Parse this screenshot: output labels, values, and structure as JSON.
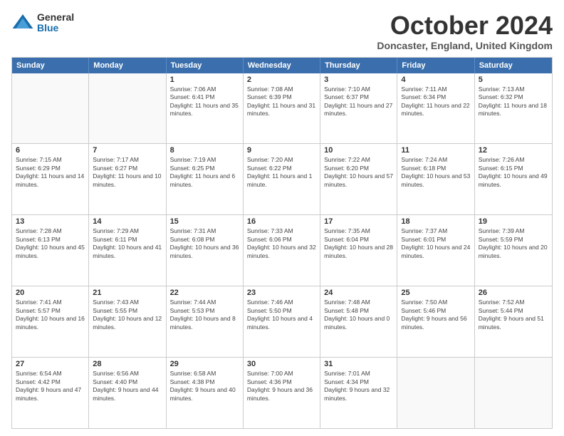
{
  "logo": {
    "general": "General",
    "blue": "Blue"
  },
  "title": "October 2024",
  "location": "Doncaster, England, United Kingdom",
  "days_of_week": [
    "Sunday",
    "Monday",
    "Tuesday",
    "Wednesday",
    "Thursday",
    "Friday",
    "Saturday"
  ],
  "weeks": [
    [
      {
        "day": "",
        "empty": true
      },
      {
        "day": "",
        "empty": true
      },
      {
        "day": "1",
        "sunrise": "Sunrise: 7:06 AM",
        "sunset": "Sunset: 6:41 PM",
        "daylight": "Daylight: 11 hours and 35 minutes."
      },
      {
        "day": "2",
        "sunrise": "Sunrise: 7:08 AM",
        "sunset": "Sunset: 6:39 PM",
        "daylight": "Daylight: 11 hours and 31 minutes."
      },
      {
        "day": "3",
        "sunrise": "Sunrise: 7:10 AM",
        "sunset": "Sunset: 6:37 PM",
        "daylight": "Daylight: 11 hours and 27 minutes."
      },
      {
        "day": "4",
        "sunrise": "Sunrise: 7:11 AM",
        "sunset": "Sunset: 6:34 PM",
        "daylight": "Daylight: 11 hours and 22 minutes."
      },
      {
        "day": "5",
        "sunrise": "Sunrise: 7:13 AM",
        "sunset": "Sunset: 6:32 PM",
        "daylight": "Daylight: 11 hours and 18 minutes."
      }
    ],
    [
      {
        "day": "6",
        "sunrise": "Sunrise: 7:15 AM",
        "sunset": "Sunset: 6:29 PM",
        "daylight": "Daylight: 11 hours and 14 minutes."
      },
      {
        "day": "7",
        "sunrise": "Sunrise: 7:17 AM",
        "sunset": "Sunset: 6:27 PM",
        "daylight": "Daylight: 11 hours and 10 minutes."
      },
      {
        "day": "8",
        "sunrise": "Sunrise: 7:19 AM",
        "sunset": "Sunset: 6:25 PM",
        "daylight": "Daylight: 11 hours and 6 minutes."
      },
      {
        "day": "9",
        "sunrise": "Sunrise: 7:20 AM",
        "sunset": "Sunset: 6:22 PM",
        "daylight": "Daylight: 11 hours and 1 minute."
      },
      {
        "day": "10",
        "sunrise": "Sunrise: 7:22 AM",
        "sunset": "Sunset: 6:20 PM",
        "daylight": "Daylight: 10 hours and 57 minutes."
      },
      {
        "day": "11",
        "sunrise": "Sunrise: 7:24 AM",
        "sunset": "Sunset: 6:18 PM",
        "daylight": "Daylight: 10 hours and 53 minutes."
      },
      {
        "day": "12",
        "sunrise": "Sunrise: 7:26 AM",
        "sunset": "Sunset: 6:15 PM",
        "daylight": "Daylight: 10 hours and 49 minutes."
      }
    ],
    [
      {
        "day": "13",
        "sunrise": "Sunrise: 7:28 AM",
        "sunset": "Sunset: 6:13 PM",
        "daylight": "Daylight: 10 hours and 45 minutes."
      },
      {
        "day": "14",
        "sunrise": "Sunrise: 7:29 AM",
        "sunset": "Sunset: 6:11 PM",
        "daylight": "Daylight: 10 hours and 41 minutes."
      },
      {
        "day": "15",
        "sunrise": "Sunrise: 7:31 AM",
        "sunset": "Sunset: 6:08 PM",
        "daylight": "Daylight: 10 hours and 36 minutes."
      },
      {
        "day": "16",
        "sunrise": "Sunrise: 7:33 AM",
        "sunset": "Sunset: 6:06 PM",
        "daylight": "Daylight: 10 hours and 32 minutes."
      },
      {
        "day": "17",
        "sunrise": "Sunrise: 7:35 AM",
        "sunset": "Sunset: 6:04 PM",
        "daylight": "Daylight: 10 hours and 28 minutes."
      },
      {
        "day": "18",
        "sunrise": "Sunrise: 7:37 AM",
        "sunset": "Sunset: 6:01 PM",
        "daylight": "Daylight: 10 hours and 24 minutes."
      },
      {
        "day": "19",
        "sunrise": "Sunrise: 7:39 AM",
        "sunset": "Sunset: 5:59 PM",
        "daylight": "Daylight: 10 hours and 20 minutes."
      }
    ],
    [
      {
        "day": "20",
        "sunrise": "Sunrise: 7:41 AM",
        "sunset": "Sunset: 5:57 PM",
        "daylight": "Daylight: 10 hours and 16 minutes."
      },
      {
        "day": "21",
        "sunrise": "Sunrise: 7:43 AM",
        "sunset": "Sunset: 5:55 PM",
        "daylight": "Daylight: 10 hours and 12 minutes."
      },
      {
        "day": "22",
        "sunrise": "Sunrise: 7:44 AM",
        "sunset": "Sunset: 5:53 PM",
        "daylight": "Daylight: 10 hours and 8 minutes."
      },
      {
        "day": "23",
        "sunrise": "Sunrise: 7:46 AM",
        "sunset": "Sunset: 5:50 PM",
        "daylight": "Daylight: 10 hours and 4 minutes."
      },
      {
        "day": "24",
        "sunrise": "Sunrise: 7:48 AM",
        "sunset": "Sunset: 5:48 PM",
        "daylight": "Daylight: 10 hours and 0 minutes."
      },
      {
        "day": "25",
        "sunrise": "Sunrise: 7:50 AM",
        "sunset": "Sunset: 5:46 PM",
        "daylight": "Daylight: 9 hours and 56 minutes."
      },
      {
        "day": "26",
        "sunrise": "Sunrise: 7:52 AM",
        "sunset": "Sunset: 5:44 PM",
        "daylight": "Daylight: 9 hours and 51 minutes."
      }
    ],
    [
      {
        "day": "27",
        "sunrise": "Sunrise: 6:54 AM",
        "sunset": "Sunset: 4:42 PM",
        "daylight": "Daylight: 9 hours and 47 minutes."
      },
      {
        "day": "28",
        "sunrise": "Sunrise: 6:56 AM",
        "sunset": "Sunset: 4:40 PM",
        "daylight": "Daylight: 9 hours and 44 minutes."
      },
      {
        "day": "29",
        "sunrise": "Sunrise: 6:58 AM",
        "sunset": "Sunset: 4:38 PM",
        "daylight": "Daylight: 9 hours and 40 minutes."
      },
      {
        "day": "30",
        "sunrise": "Sunrise: 7:00 AM",
        "sunset": "Sunset: 4:36 PM",
        "daylight": "Daylight: 9 hours and 36 minutes."
      },
      {
        "day": "31",
        "sunrise": "Sunrise: 7:01 AM",
        "sunset": "Sunset: 4:34 PM",
        "daylight": "Daylight: 9 hours and 32 minutes."
      },
      {
        "day": "",
        "empty": true
      },
      {
        "day": "",
        "empty": true
      }
    ]
  ]
}
